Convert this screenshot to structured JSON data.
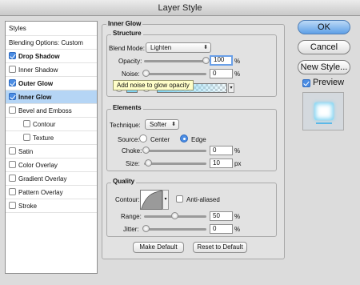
{
  "window": {
    "title": "Layer Style"
  },
  "styles_list": {
    "header": "Styles",
    "blending": "Blending Options: Custom",
    "items": [
      {
        "label": "Drop Shadow",
        "checked": true
      },
      {
        "label": "Inner Shadow",
        "checked": false
      },
      {
        "label": "Outer Glow",
        "checked": true
      },
      {
        "label": "Inner Glow",
        "checked": true,
        "selected": true
      },
      {
        "label": "Bevel and Emboss",
        "checked": false
      },
      {
        "label": "Contour",
        "checked": false
      },
      {
        "label": "Texture",
        "checked": false
      },
      {
        "label": "Satin",
        "checked": false
      },
      {
        "label": "Color Overlay",
        "checked": false
      },
      {
        "label": "Gradient Overlay",
        "checked": false
      },
      {
        "label": "Pattern Overlay",
        "checked": false
      },
      {
        "label": "Stroke",
        "checked": false
      }
    ]
  },
  "panel": {
    "title": "Inner Glow",
    "structure": {
      "title": "Structure",
      "blend_mode_label": "Blend Mode:",
      "blend_mode_value": "Lighten",
      "opacity_label": "Opacity:",
      "opacity_value": "100",
      "opacity_unit": "%",
      "noise_label": "Noise:",
      "noise_value": "0",
      "noise_unit": "%",
      "tooltip": "Add noise to glow opacity"
    },
    "elements": {
      "title": "Elements",
      "technique_label": "Technique:",
      "technique_value": "Softer",
      "source_label": "Source:",
      "source_center": "Center",
      "source_edge": "Edge",
      "choke_label": "Choke:",
      "choke_value": "0",
      "choke_unit": "%",
      "size_label": "Size:",
      "size_value": "10",
      "size_unit": "px"
    },
    "quality": {
      "title": "Quality",
      "contour_label": "Contour:",
      "anti_aliased": "Anti-aliased",
      "range_label": "Range:",
      "range_value": "50",
      "range_unit": "%",
      "jitter_label": "Jitter:",
      "jitter_value": "0",
      "jitter_unit": "%"
    },
    "make_default": "Make Default",
    "reset_default": "Reset to Default"
  },
  "actions": {
    "ok": "OK",
    "cancel": "Cancel",
    "new_style": "New Style...",
    "preview": "Preview"
  },
  "colors": {
    "accent": "#4b8de4",
    "selection": "#b5d5f5",
    "glow": "#7fd3f2"
  }
}
